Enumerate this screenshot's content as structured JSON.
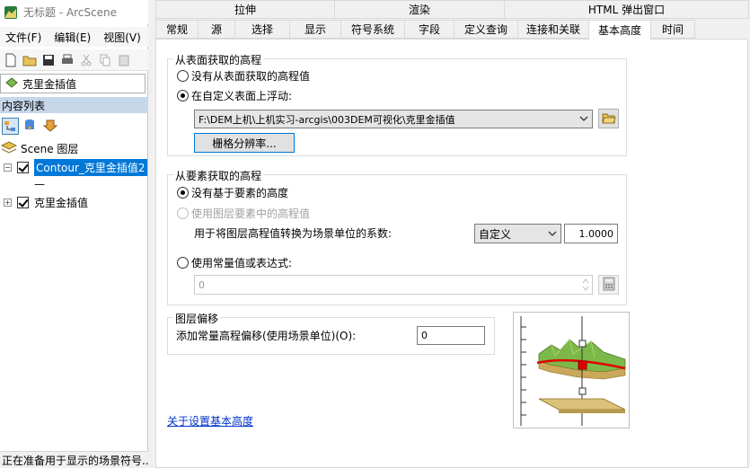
{
  "app": {
    "title": "无标题 - ArcScene",
    "menu": [
      "文件(F)",
      "编辑(E)",
      "视图(V)"
    ],
    "layer_combo": "克里金插值",
    "toc_header": "内容列表",
    "tree": {
      "root": "Scene 图层",
      "layer1": "Contour_克里金插值2",
      "layer1_legend": "—",
      "layer2": "克里金插值"
    },
    "status": "正在准备用于显示的场景符号..."
  },
  "dialog": {
    "tabs_row1": [
      "拉伸",
      "渲染",
      "HTML 弹出窗口"
    ],
    "tabs_row2": [
      "常规",
      "源",
      "选择",
      "显示",
      "符号系统",
      "字段",
      "定义查询",
      "连接和关联",
      "基本高度",
      "时间"
    ],
    "active_tab": "基本高度",
    "surface_group": {
      "title": "从表面获取的高程",
      "opt_none": "没有从表面获取的高程值",
      "opt_float": "在自定义表面上浮动:",
      "surface_path": "F:\\DEM上机\\上机实习-arcgis\\003DEM可视化\\克里金插值",
      "raster_button": "栅格分辨率..."
    },
    "feature_group": {
      "title": "从要素获取的高程",
      "opt_none": "没有基于要素的高度",
      "opt_layer": "使用图层要素中的高程值",
      "factor_label": "用于将图层高程值转换为场景单位的系数:",
      "factor_unit": "自定义",
      "factor_value": "1.0000",
      "opt_expr": "使用常量值或表达式:",
      "expr_value": "0"
    },
    "offset_group": {
      "title": "图层偏移",
      "label": "添加常量高程偏移(使用场景单位)(O):",
      "value": "0"
    },
    "help_link": "关于设置基本高度"
  },
  "icons": {
    "browse": "folder-open-icon",
    "calculator": "calculator-icon"
  },
  "colors": {
    "selection_blue": "#0078d7",
    "link_blue": "#0033cc",
    "surface_red": "#e00000",
    "terrain_green": "#7db84a",
    "plane_tan": "#dcc17a"
  }
}
